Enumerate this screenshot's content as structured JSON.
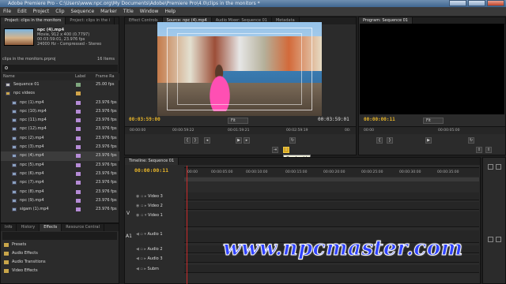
{
  "window": {
    "title": "Adobe Premiere Pro - C:\\Users\\www.npc.org\\My Documents\\Adobe\\Premiere Pro\\4.0\\clips in the monitors *"
  },
  "menu": [
    "File",
    "Edit",
    "Project",
    "Clip",
    "Sequence",
    "Marker",
    "Title",
    "Window",
    "Help"
  ],
  "project_panel": {
    "tabs": [
      "Project: clips in the monitors",
      "Project: clips in the i"
    ],
    "clip_name": "npc (4).mp4",
    "clip_meta": [
      "Movie, 912 x 400 (0.7797)",
      "00:03:59:01, 23.976 fps",
      "24000 Hz - Compressed - Stereo"
    ],
    "project_file": "clips in the monitors.prproj",
    "item_count": "16 Items",
    "col_name": "Name",
    "col_label": "Label",
    "col_fps": "Frame Ra",
    "items": [
      {
        "name": "Sequence 01",
        "fps": "25.00 fps",
        "type": "seq"
      },
      {
        "name": "npc videos",
        "fps": "",
        "type": "folder"
      },
      {
        "name": "npc (1).mp4",
        "fps": "23.976 fps",
        "type": "clip"
      },
      {
        "name": "npc (10).mp4",
        "fps": "23.976 fps",
        "type": "clip"
      },
      {
        "name": "npc (11).mp4",
        "fps": "23.976 fps",
        "type": "clip"
      },
      {
        "name": "npc (12).mp4",
        "fps": "23.976 fps",
        "type": "clip"
      },
      {
        "name": "npc (2).mp4",
        "fps": "23.976 fps",
        "type": "clip"
      },
      {
        "name": "npc (3).mp4",
        "fps": "23.976 fps",
        "type": "clip"
      },
      {
        "name": "npc (4).mp4",
        "fps": "23.976 fps",
        "type": "clip"
      },
      {
        "name": "npc (5).mp4",
        "fps": "23.976 fps",
        "type": "clip"
      },
      {
        "name": "npc (6).mp4",
        "fps": "23.976 fps",
        "type": "clip"
      },
      {
        "name": "npc (7).mp4",
        "fps": "23.976 fps",
        "type": "clip"
      },
      {
        "name": "npc (8).mp4",
        "fps": "23.976 fps",
        "type": "clip"
      },
      {
        "name": "npc (9).mp4",
        "fps": "23.976 fps",
        "type": "clip"
      },
      {
        "name": "sigam (1).mp4",
        "fps": "23.976 fps",
        "type": "clip"
      }
    ]
  },
  "effects_panel": {
    "tabs": [
      "Info",
      "History",
      "Effects",
      "Resource Central"
    ],
    "items": [
      "Presets",
      "Audio Effects",
      "Audio Transitions",
      "Video Effects"
    ]
  },
  "source_monitor": {
    "tabs": [
      "Effect Controls",
      "Source: npc (4).mp4",
      "Audio Mixer: Sequence 01",
      "Metadata"
    ],
    "timecode_in": "00:03:59:00",
    "fit": "Fit",
    "timecode_dur": "00:03:59:01",
    "ruler": [
      "00:00:00",
      "00:00:59:22",
      "00:01:59:21",
      "00:02:59:19",
      "00:"
    ]
  },
  "program_monitor": {
    "tab": "Program: Sequence 01",
    "timecode": "00:00:00:11",
    "fit": "Fit",
    "ruler": [
      "00:00",
      "00:00:05:00"
    ]
  },
  "tooltip": "Overlay (,)",
  "timeline": {
    "tab": "Timeline: Sequence 01",
    "timecode": "00:00:00:11",
    "ruler": [
      "00:00",
      "00:00:05:00",
      "00:00:10:00",
      "00:00:15:00",
      "00:00:20:00",
      "00:00:25:00",
      "00:00:30:00",
      "00:00:35:00"
    ],
    "video_tracks": [
      "Video 3",
      "Video 2",
      "Video 1"
    ],
    "audio_tracks": [
      "Audio 1",
      "Audio 2",
      "Audio 3",
      "Subm"
    ],
    "video_target": "V",
    "audio_target": "A1"
  },
  "watermark": "www.npcmaster.com"
}
